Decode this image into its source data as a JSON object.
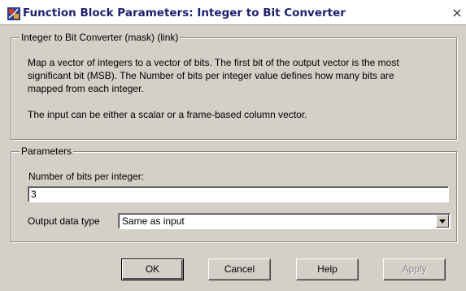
{
  "window": {
    "title": "Function Block Parameters: Integer to Bit Converter",
    "close_glyph": "×"
  },
  "mask_group": {
    "legend": "Integer to Bit Converter (mask) (link)",
    "description_lines": [
      "Map a vector of integers to a vector of bits. The first bit of the output vector is the most",
      "significant bit (MSB). The Number of bits per integer value defines how many bits are",
      "mapped from each integer."
    ],
    "description_extra": "The input can be either a scalar or a frame-based column vector."
  },
  "params_group": {
    "legend": "Parameters",
    "bits_label": "Number of bits per integer:",
    "bits_value": "3",
    "output_type_label": "Output data type",
    "output_type_value": "Same as input"
  },
  "buttons": {
    "ok": "OK",
    "cancel": "Cancel",
    "help": "Help",
    "apply": "Apply"
  },
  "icons": {
    "title": "simulink-block-icon",
    "dropdown": "chevron-down-icon"
  }
}
